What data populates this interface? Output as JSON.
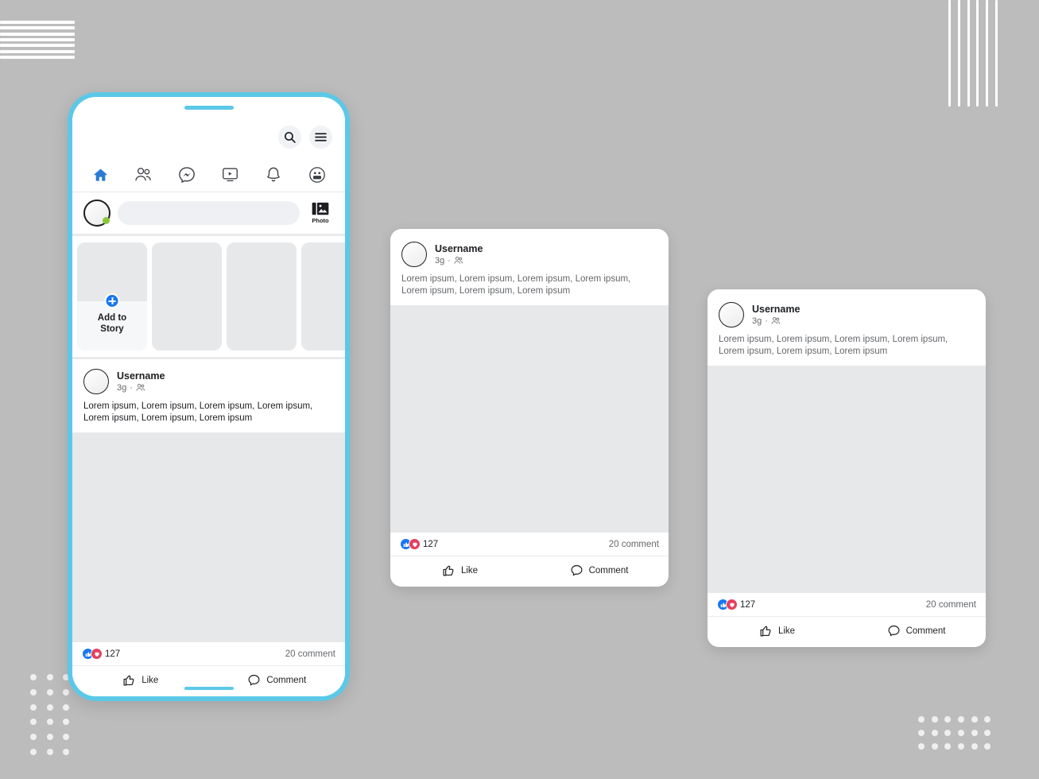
{
  "background": {
    "color": "#bcbcbc",
    "accent_blue": "#5cc8e8",
    "brand_blue": "#1877f2",
    "love_red": "#e4405f"
  },
  "phone": {
    "topbar": {
      "search_icon": "search-icon",
      "menu_icon": "hamburger-menu-icon"
    },
    "nav": [
      {
        "name": "home",
        "icon": "home-icon",
        "active": true
      },
      {
        "name": "friends",
        "icon": "friends-icon",
        "active": false
      },
      {
        "name": "messenger",
        "icon": "messenger-icon",
        "active": false
      },
      {
        "name": "watch",
        "icon": "video-icon",
        "active": false
      },
      {
        "name": "notifications",
        "icon": "bell-icon",
        "active": false
      },
      {
        "name": "groups",
        "icon": "groups-icon",
        "active": false
      }
    ],
    "composer": {
      "placeholder": "",
      "value": "",
      "photo_label": "Photo",
      "photo_icon": "photo-icon",
      "avatar_icon": "user-avatar",
      "online_status": true
    },
    "stories": {
      "add_label": "Add to\nStory",
      "add_label_line1": "Add to",
      "add_label_line2": "Story",
      "plus_icon": "plus-circle-icon",
      "placeholder_count": 3
    }
  },
  "post": {
    "username": "Username",
    "time": "3g",
    "separator": "·",
    "audience_icon": "friends-audience-icon",
    "body": "Lorem ipsum, Lorem ipsum, Lorem ipsum, Lorem ipsum, Lorem ipsum, Lorem ipsum, Lorem ipsum",
    "reactions": {
      "like_icon": "thumbs-up-icon",
      "love_icon": "heart-icon",
      "count": "127"
    },
    "comments_count": "20 comment",
    "actions": {
      "like_label": "Like",
      "like_icon": "thumbs-up-outline-icon",
      "comment_label": "Comment",
      "comment_icon": "comment-bubble-icon"
    }
  },
  "cards": [
    {
      "id": "card-middle"
    },
    {
      "id": "card-right"
    }
  ]
}
